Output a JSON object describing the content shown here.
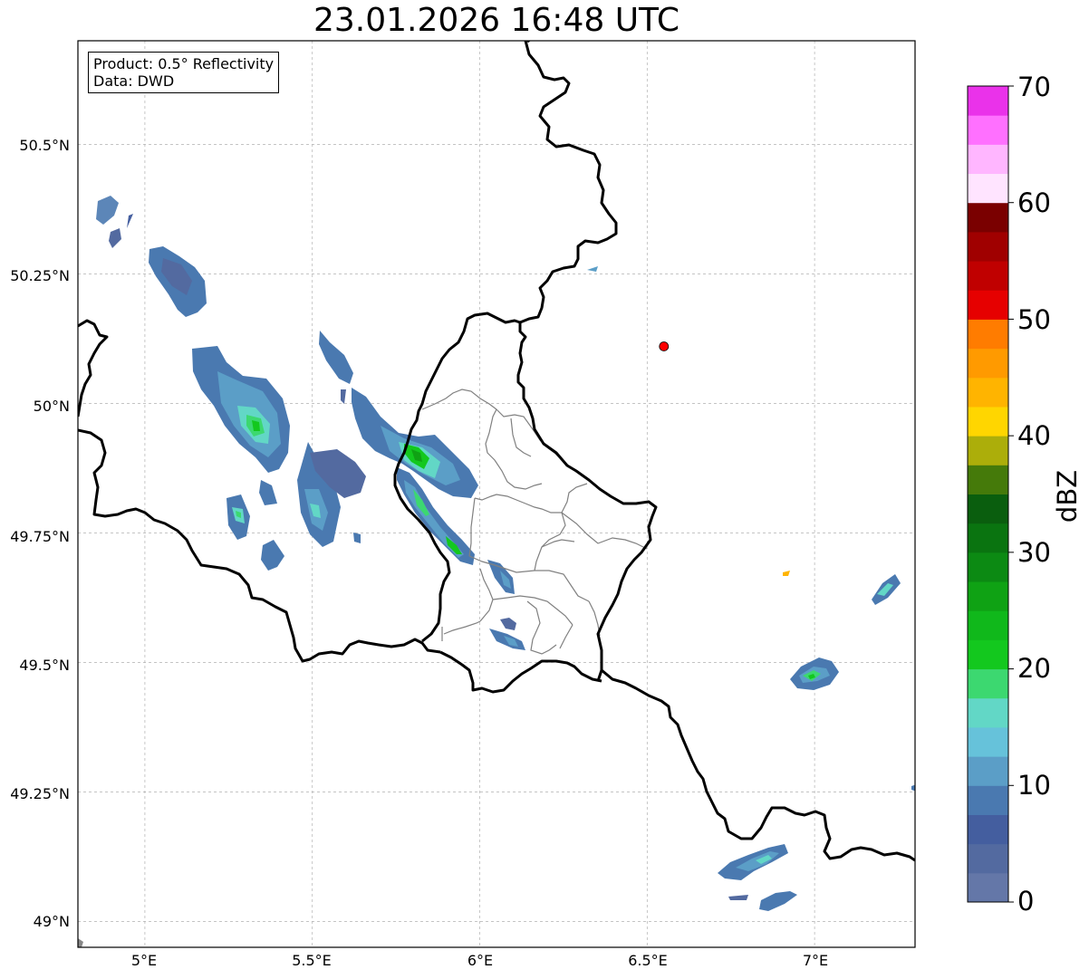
{
  "title": "23.01.2026 16:48 UTC",
  "info_box": {
    "product": "Product: 0.5° Reflectivity",
    "data": "Data: DWD"
  },
  "axes": {
    "lat_ticks": [
      "50.5°N",
      "50.25°N",
      "50°N",
      "49.75°N",
      "49.5°N",
      "49.25°N",
      "49°N"
    ],
    "lon_ticks": [
      "5°E",
      "5.5°E",
      "6°E",
      "6.5°E",
      "7°E"
    ],
    "lon_range": [
      4.8,
      7.3
    ],
    "lat_range": [
      48.95,
      50.7
    ]
  },
  "colorbar": {
    "label": "dBZ",
    "tick_labels": [
      "0",
      "10",
      "20",
      "30",
      "40",
      "50",
      "60",
      "70"
    ],
    "range": [
      0,
      70
    ],
    "colors": [
      "#6477a8",
      "#536aa0",
      "#445e9f",
      "#4a79b0",
      "#5b9ec7",
      "#66c2da",
      "#62d7c6",
      "#3cd870",
      "#13c81e",
      "#10b81b",
      "#0fa214",
      "#0c8a13",
      "#0a7410",
      "#0a5e0e",
      "#457a0a",
      "#acae0a",
      "#ffd600",
      "#ffb400",
      "#ff9a00",
      "#ff7c00",
      "#e60000",
      "#c00000",
      "#a00000",
      "#7a0000",
      "#ffe4ff",
      "#ffb6ff",
      "#ff70ff",
      "#ea32ea"
    ]
  },
  "marker": {
    "color": "#ff0000",
    "lon": 6.55,
    "lat": 50.11
  },
  "colors": {
    "border": "#000000",
    "region_border": "#808080",
    "grid": "#b0b0b0"
  }
}
